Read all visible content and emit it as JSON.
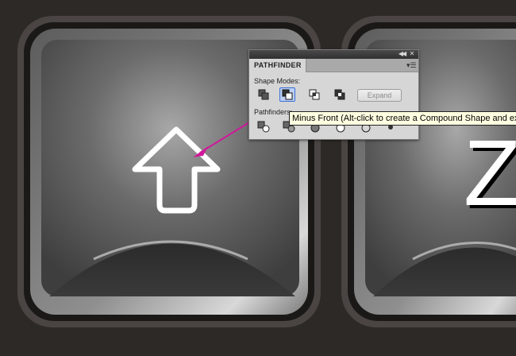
{
  "panel": {
    "tab_label": "PATHFINDER",
    "shape_modes_label": "Shape Modes:",
    "pathfinders_label": "Pathfinders:",
    "expand_label": "Expand",
    "collapse_icon": "double-chevron-left-icon",
    "close_icon": "close-icon",
    "menu_icon": "panel-menu-icon",
    "shape_modes": [
      "unite",
      "minus-front",
      "intersect",
      "exclude"
    ],
    "selected_shape_mode": "minus-front",
    "pathfinders": [
      "divide",
      "trim",
      "merge",
      "crop",
      "outline",
      "minus-back"
    ]
  },
  "tooltip": {
    "text": "Minus Front (Alt-click to create a Compound Shape and expand)"
  },
  "canvas": {
    "key_left_icon": "up-arrow-icon",
    "key_right_letter": "Z",
    "annotation_arrow_color": "#d0199a"
  },
  "colors": {
    "background": "#2d2926",
    "panel_bg": "#d6d6d6",
    "tooltip_bg": "#ffffe1",
    "selection_blue": "#3b6fd6"
  }
}
